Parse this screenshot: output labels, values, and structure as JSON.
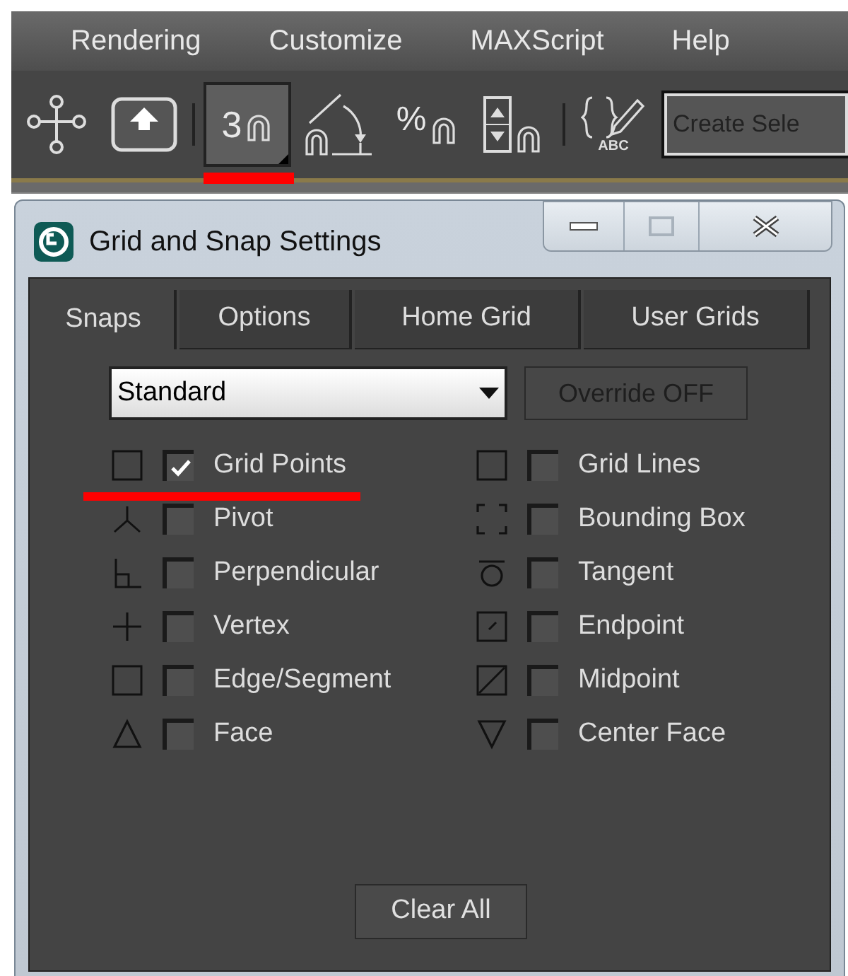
{
  "menu_bar": {
    "items": [
      "Rendering",
      "Customize",
      "MAXScript",
      "Help"
    ]
  },
  "toolbar": {
    "buttons": [
      {
        "kind": "hierarchy",
        "pressed": false,
        "highlighted": false
      },
      {
        "kind": "upload",
        "pressed": false,
        "highlighted": false
      },
      {
        "kind": "snap",
        "text": "3",
        "pressed": true,
        "highlighted": true
      },
      {
        "kind": "angle",
        "pressed": false,
        "highlighted": false
      },
      {
        "kind": "percent",
        "text": "%",
        "pressed": false,
        "highlighted": false
      },
      {
        "kind": "spinner",
        "pressed": false,
        "highlighted": false
      },
      {
        "kind": "edit_named",
        "text": "ABC",
        "pressed": false,
        "highlighted": false
      }
    ],
    "selection_field": {
      "value": "Create Sele"
    }
  },
  "dialog": {
    "title": "Grid and Snap Settings",
    "tabs": [
      {
        "label": "Snaps",
        "selected": true
      },
      {
        "label": "Options",
        "selected": false
      },
      {
        "label": "Home Grid",
        "selected": false
      },
      {
        "label": "User Grids",
        "selected": false
      }
    ],
    "dropdown": {
      "value": "Standard"
    },
    "override_button": {
      "label": "Override OFF",
      "disabled": true
    },
    "snaps": [
      {
        "label": "Grid Points",
        "checked": true,
        "highlighted": true
      },
      {
        "label": "Grid Lines",
        "checked": false,
        "highlighted": false
      },
      {
        "label": "Pivot",
        "checked": false,
        "highlighted": false
      },
      {
        "label": "Bounding Box",
        "checked": false,
        "highlighted": false
      },
      {
        "label": "Perpendicular",
        "checked": false,
        "highlighted": false
      },
      {
        "label": "Tangent",
        "checked": false,
        "highlighted": false
      },
      {
        "label": "Vertex",
        "checked": false,
        "highlighted": false
      },
      {
        "label": "Endpoint",
        "checked": false,
        "highlighted": false
      },
      {
        "label": "Edge/Segment",
        "checked": false,
        "highlighted": false
      },
      {
        "label": "Midpoint",
        "checked": false,
        "highlighted": false
      },
      {
        "label": "Face",
        "checked": false,
        "highlighted": false
      },
      {
        "label": "Center Face",
        "checked": false,
        "highlighted": false
      }
    ],
    "clear_button": {
      "label": "Clear All"
    }
  }
}
